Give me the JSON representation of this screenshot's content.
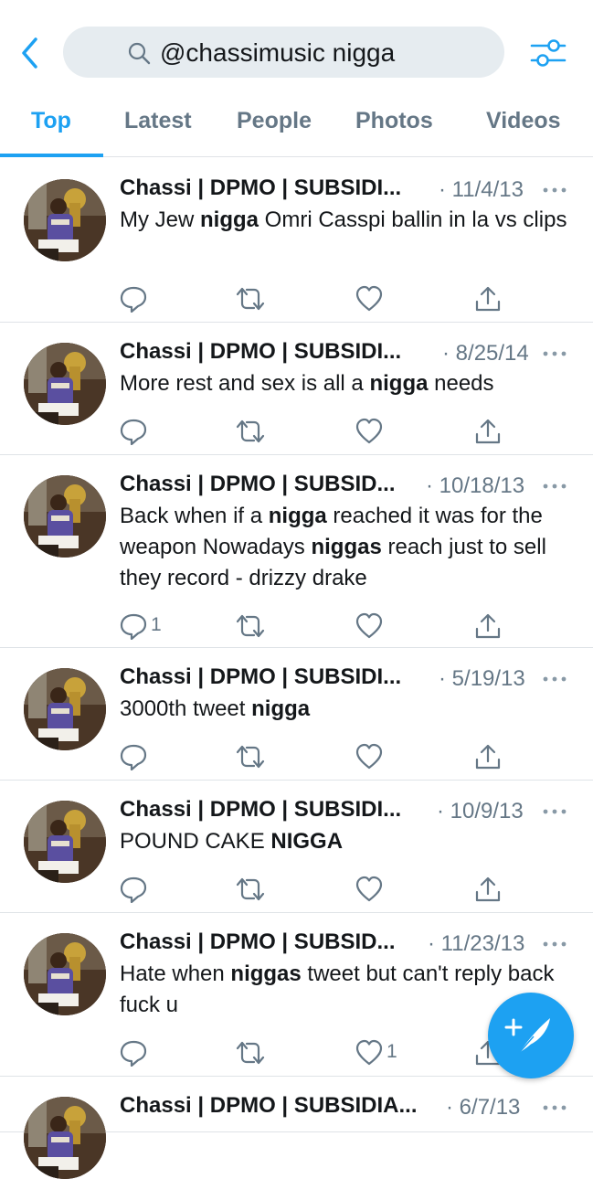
{
  "search": {
    "query": "@chassimusic nigga"
  },
  "tabs": [
    {
      "label": "Top"
    },
    {
      "label": "Latest"
    },
    {
      "label": "People"
    },
    {
      "label": "Photos"
    },
    {
      "label": "Videos"
    }
  ],
  "tweets": [
    {
      "name": "Chassi | DPMO | SUBSIDI...",
      "date": "11/4/13",
      "text_parts": [
        "My Jew ",
        "nigga",
        " Omri Casspi ballin in la vs clips"
      ],
      "reply_count": "",
      "like_count": ""
    },
    {
      "name": "Chassi | DPMO | SUBSIDI...",
      "date": "8/25/14",
      "text_parts": [
        "More rest and sex is all a ",
        "nigga",
        " needs"
      ],
      "reply_count": "",
      "like_count": ""
    },
    {
      "name": "Chassi | DPMO | SUBSID...",
      "date": "10/18/13",
      "text_parts": [
        "Back when if a ",
        "nigga",
        " reached it was for the weapon Nowadays ",
        "niggas",
        " reach just to sell they record - drizzy drake"
      ],
      "reply_count": "1",
      "like_count": ""
    },
    {
      "name": "Chassi | DPMO | SUBSIDI...",
      "date": "5/19/13",
      "text_parts": [
        "3000th tweet ",
        "nigga"
      ],
      "reply_count": "",
      "like_count": ""
    },
    {
      "name": "Chassi | DPMO | SUBSIDI...",
      "date": "10/9/13",
      "text_parts": [
        "POUND CAKE ",
        "NIGGA"
      ],
      "reply_count": "",
      "like_count": ""
    },
    {
      "name": "Chassi | DPMO | SUBSID...",
      "date": "11/23/13",
      "text_parts": [
        "Hate when ",
        "niggas",
        " tweet but can't reply back fuck u"
      ],
      "reply_count": "",
      "like_count": "1"
    },
    {
      "name": "Chassi | DPMO | SUBSIDIA...",
      "date": "6/7/13",
      "text_parts": [],
      "reply_count": "",
      "like_count": ""
    }
  ],
  "colors": {
    "accent": "#1da1f2",
    "muted": "#657786",
    "divider": "#dfe3e7"
  },
  "icons": [
    "back-arrow-icon",
    "search-icon",
    "filter-icon",
    "more-icon",
    "reply-icon",
    "retweet-icon",
    "like-icon",
    "share-icon",
    "compose-icon"
  ]
}
